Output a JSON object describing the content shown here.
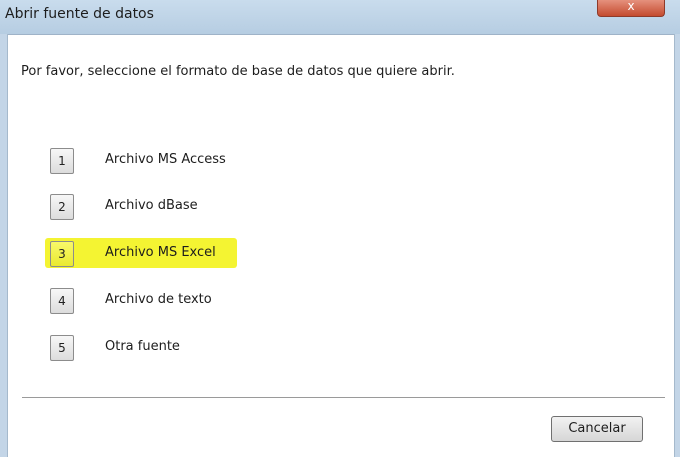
{
  "window": {
    "title": "Abrir fuente de datos",
    "close_label": "x"
  },
  "instruction": "Por favor, seleccione el formato de base de datos que quiere abrir.",
  "options": [
    {
      "number": "1",
      "label": "Archivo MS Access"
    },
    {
      "number": "2",
      "label": "Archivo dBase"
    },
    {
      "number": "3",
      "label": "Archivo MS Excel"
    },
    {
      "number": "4",
      "label": "Archivo de texto"
    },
    {
      "number": "5",
      "label": "Otra fuente"
    }
  ],
  "highlighted_option": "3",
  "highlight_color": "#f4f432",
  "cancel_label": "Cancelar"
}
